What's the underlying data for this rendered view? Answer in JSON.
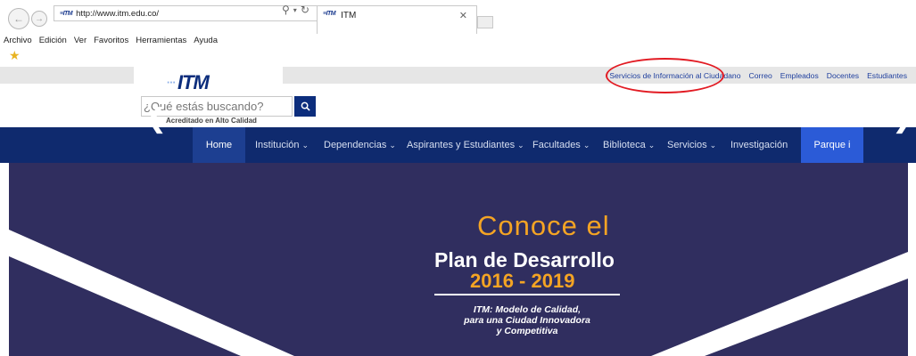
{
  "browser": {
    "url": "http://www.itm.edu.co/",
    "tab_title": "ITM",
    "menu": [
      "Archivo",
      "Edición",
      "Ver",
      "Favoritos",
      "Herramientas",
      "Ayuda"
    ]
  },
  "header": {
    "logo_text": "ITM",
    "utility_links": [
      "Servicios de Información al Ciudadano",
      "Correo",
      "Empleados",
      "Docentes",
      "Estudiantes"
    ],
    "search": {
      "placeholder": "¿Qué estás buscando?"
    },
    "accreditation": "Acreditado en Alto Calidad"
  },
  "nav": {
    "home": "Home",
    "items": [
      "Institución",
      "Dependencias",
      "Aspirantes y Estudiantes",
      "Facultades",
      "Biblioteca",
      "Servicios"
    ],
    "investigacion": "Investigación",
    "parque": "Parque i"
  },
  "hero": {
    "conoce": "Conoce el",
    "plan": "Plan de Desarrollo",
    "years": "2016 - 2019",
    "tagline": [
      "ITM: Modelo de Calidad,",
      "para una Ciudad Innovadora",
      "y Competitiva"
    ]
  },
  "colors": {
    "nav_bg": "#0f2a6e",
    "brand_blue": "#0c2d7c",
    "hero_bg": "#302e5f",
    "accent_orange": "#f4a424",
    "parque_bg": "#2b5bd7",
    "annotation_red": "#e21b23"
  },
  "icons": [
    "back-arrow-icon",
    "forward-arrow-icon",
    "search-icon",
    "refresh-icon",
    "favorites-star-icon",
    "chevron-down-icon",
    "slider-prev-icon",
    "slider-next-icon"
  ]
}
